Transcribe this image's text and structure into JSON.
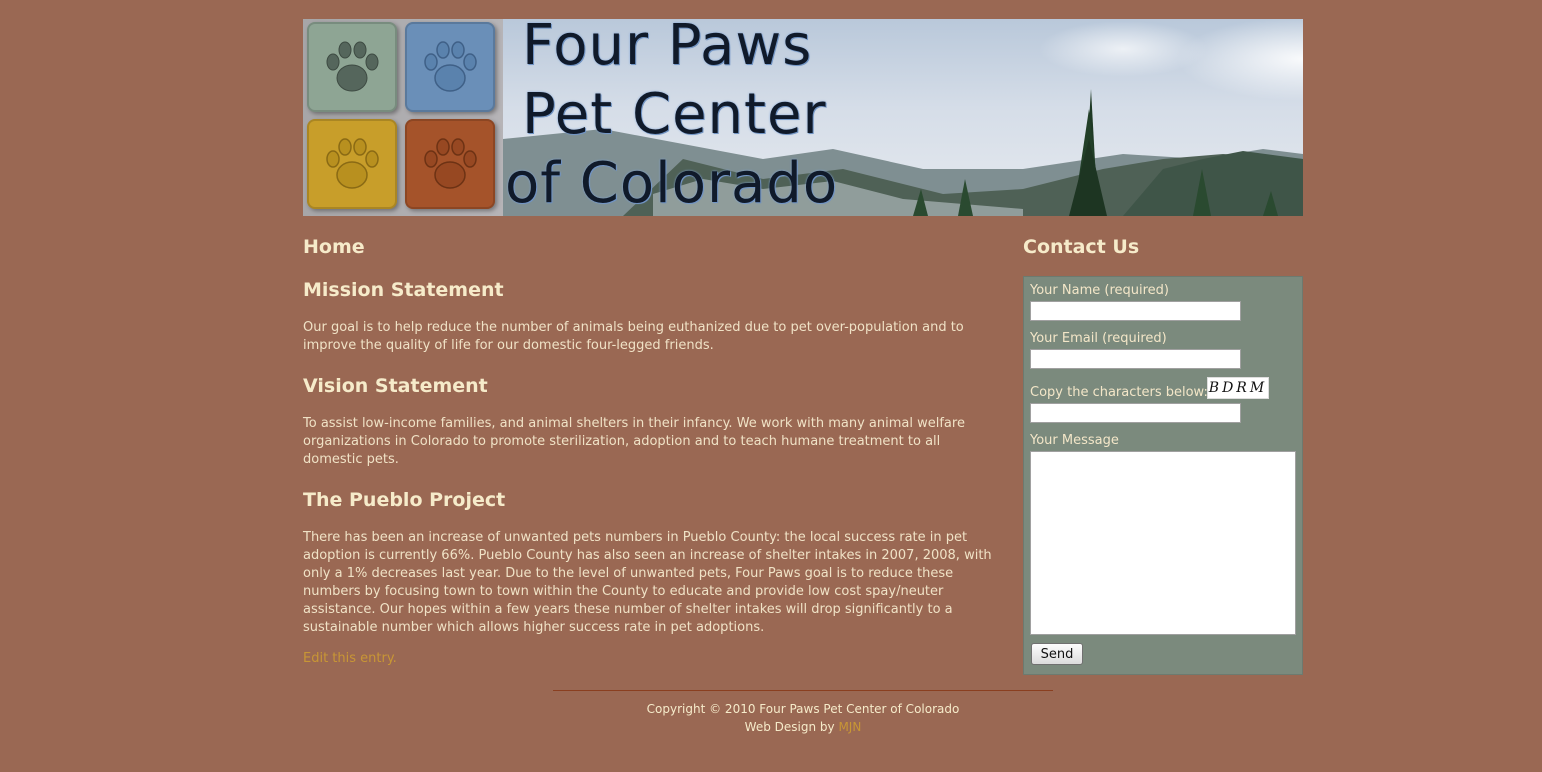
{
  "banner": {
    "title_line1": "Four Paws",
    "title_line2": "Pet Center",
    "title_line3": "of Colorado"
  },
  "main": {
    "page_title": "Home",
    "sections": [
      {
        "title": "Mission Statement",
        "body": "Our goal is to help reduce the number of animals being euthanized due to pet over-population and to improve the quality of life for our domestic four-legged friends."
      },
      {
        "title": "Vision Statement",
        "body": "To assist low-income families, and animal shelters in their infancy. We work with many animal welfare organizations in Colorado to promote sterilization, adoption and to teach humane treatment to all domestic pets."
      },
      {
        "title": "The Pueblo Project",
        "body": "There has been an increase of unwanted pets numbers in Pueblo County: the local success rate in pet adoption is currently 66%. Pueblo County has also seen an increase of shelter intakes in 2007, 2008, with only a 1% decreases last year. Due to the level of unwanted pets, Four Paws goal is to reduce these numbers by focusing town to town within the County to educate and provide low cost spay/neuter assistance. Our hopes within a few years these number of shelter intakes will drop significantly to a sustainable number which allows higher success rate in pet adoptions."
      }
    ],
    "edit_link": "Edit this entry."
  },
  "contact": {
    "title": "Contact Us",
    "name_label": "Your Name (required)",
    "name_value": "",
    "email_label": "Your Email (required)",
    "email_value": "",
    "captcha_label": "Copy the characters below:",
    "captcha_text": "BDRM",
    "captcha_value": "",
    "message_label": "Your Message",
    "message_value": "",
    "send_label": "Send"
  },
  "footer": {
    "copyright": "Copyright © 2010 Four Paws Pet Center of Colorado",
    "design_prefix": "Web Design by ",
    "design_link": "MJN"
  },
  "colors": {
    "page_bg": "#9a6853",
    "form_bg": "#7b8a7d",
    "link": "#c89635",
    "heading": "#f6ebca"
  },
  "icons": {
    "banner_tiles": [
      "paw-print-icon",
      "paw-print-icon",
      "paw-print-icon",
      "paw-print-icon"
    ]
  }
}
